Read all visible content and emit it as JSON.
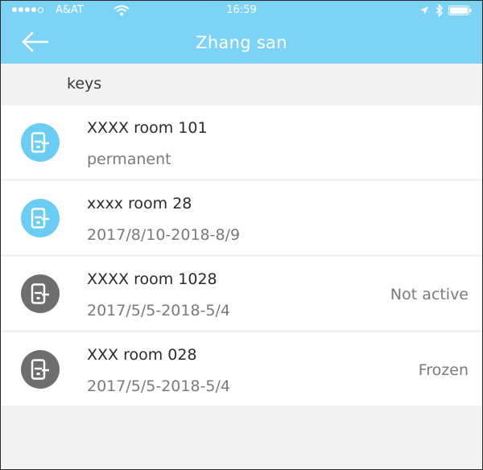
{
  "status_bar": {
    "carrier": "A&AT",
    "time": "16:59",
    "icons": [
      "signal-dots",
      "wifi-icon",
      "location-icon",
      "bluetooth-icon",
      "battery-icon"
    ]
  },
  "nav": {
    "back_icon": "arrow-left-icon",
    "title": "Zhang san"
  },
  "section": {
    "title": "keys"
  },
  "keys": [
    {
      "name": "XXXX room 101",
      "validity": "permanent",
      "status": "",
      "icon": "door-lock-icon",
      "icon_color": "#6bcdf4"
    },
    {
      "name": "xxxx room 28",
      "validity": "2017/8/10-2018-8/9",
      "status": "",
      "icon": "door-lock-icon",
      "icon_color": "#6bcdf4"
    },
    {
      "name": "XXXX room 1028",
      "validity": "2017/5/5-2018-5/4",
      "status": "Not active",
      "icon": "door-lock-icon",
      "icon_color": "#6e6e6e"
    },
    {
      "name": "XXX room 028",
      "validity": "2017/5/5-2018-5/4",
      "status": "Frozen",
      "icon": "door-lock-icon",
      "icon_color": "#6e6e6e"
    }
  ],
  "colors": {
    "header_bg": "#7dd3f5",
    "active_icon": "#6bcdf4",
    "inactive_icon": "#6e6e6e",
    "list_bg": "#f2f2f2"
  }
}
